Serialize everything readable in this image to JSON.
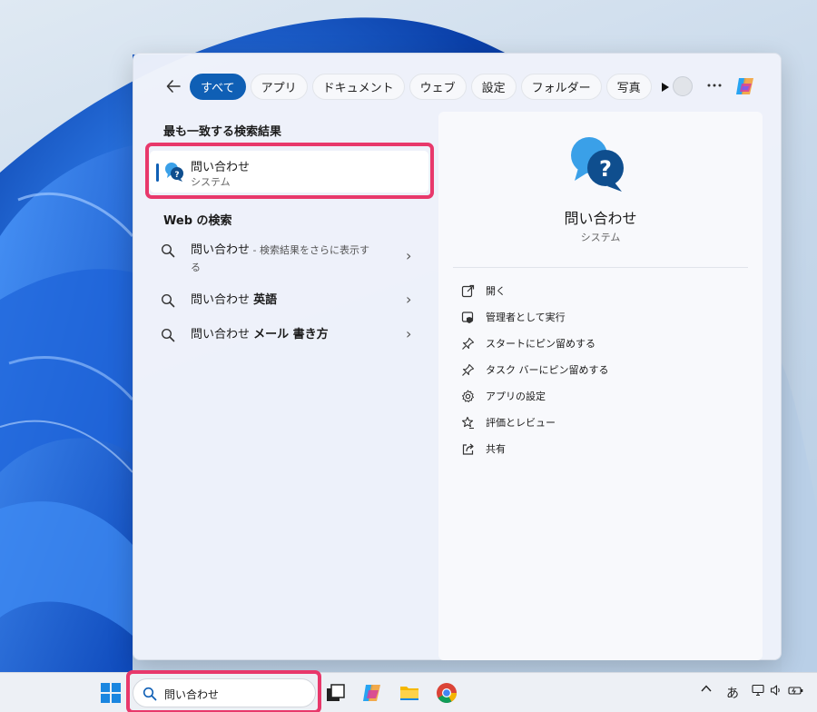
{
  "search_panel": {
    "filter_chips": [
      "すべて",
      "アプリ",
      "ドキュメント",
      "ウェブ",
      "設定",
      "フォルダー",
      "写真"
    ],
    "best_match_heading": "最も一致する検索結果",
    "best_match": {
      "name": "問い合わせ",
      "type": "システム"
    },
    "web_heading": "Web の検索",
    "web_results": [
      {
        "query": "問い合わせ",
        "hint": " - 検索結果をさらに表示す",
        "hint_wrap": "る"
      },
      {
        "query": "問い合わせ",
        "suffix": "英語"
      },
      {
        "query": "問い合わせ",
        "suffix": "メール 書き方"
      }
    ],
    "detail": {
      "title": "問い合わせ",
      "subtitle": "システム",
      "actions": [
        {
          "label": "開く",
          "icon": "open-external-icon"
        },
        {
          "label": "管理者として実行",
          "icon": "admin-shield-icon"
        },
        {
          "label": "スタートにピン留めする",
          "icon": "pin-icon"
        },
        {
          "label": "タスク バーにピン留めする",
          "icon": "pin-icon"
        },
        {
          "label": "アプリの設定",
          "icon": "gear-icon"
        },
        {
          "label": "評価とレビュー",
          "icon": "star-review-icon"
        },
        {
          "label": "共有",
          "icon": "share-icon"
        }
      ]
    }
  },
  "taskbar": {
    "search_query": "問い合わせ",
    "ime_indicator": "あ",
    "tray_chevron": "^",
    "apps": [
      "start-icon",
      "task-view-icon",
      "copilot-icon",
      "file-explorer-icon",
      "chrome-icon"
    ]
  },
  "colors": {
    "accent": "#0f5fb5",
    "highlight": "#e8386b"
  }
}
